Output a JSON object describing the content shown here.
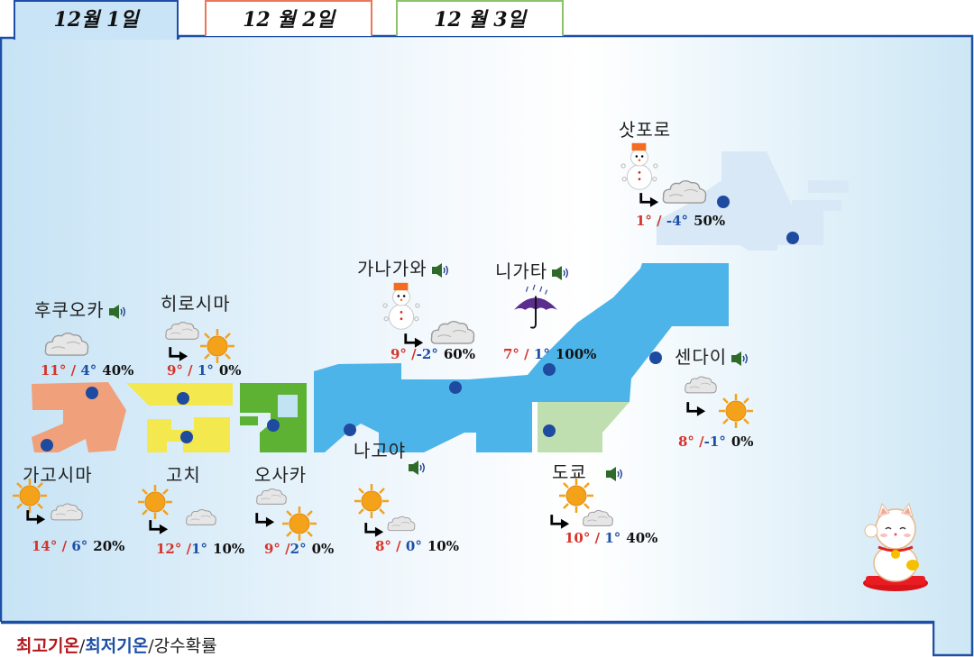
{
  "tabs": [
    "12월 1일",
    "12 월 2일",
    "12 월 3일"
  ],
  "colors": {
    "active_tab": "#c8e4f6",
    "border": "#1e4fa6",
    "high_temp": "#d6332a",
    "low_temp": "#1e4fa6",
    "dot": "#1e4aa0"
  },
  "cities": {
    "sapporo": {
      "name": "삿포로",
      "high": "1°",
      "low": "-4°",
      "rain": "50%",
      "weather": [
        "snowman",
        "cloud"
      ]
    },
    "kanazawa": {
      "name": "가나가와",
      "high": "9°",
      "low": "-2°",
      "rain": "60%",
      "weather": [
        "snowman",
        "cloud"
      ]
    },
    "niigata": {
      "name": "니가타",
      "high": "7°",
      "low": "1°",
      "rain": "100%",
      "weather": [
        "umbrella"
      ]
    },
    "fukuoka": {
      "name": "후쿠오카",
      "high": "11°",
      "low": "4°",
      "rain": "40%",
      "weather": [
        "cloud"
      ]
    },
    "hiroshima": {
      "name": "히로시마",
      "high": "9°",
      "low": "1°",
      "rain": "0%",
      "weather": [
        "cloud",
        "sun"
      ]
    },
    "sendai": {
      "name": "센다이",
      "high": "8°",
      "low": "-1°",
      "rain": "0%",
      "weather": [
        "cloud",
        "sun"
      ]
    },
    "kagoshima": {
      "name": "가고시마",
      "high": "14°",
      "low": "6°",
      "rain": "20%",
      "weather": [
        "sun",
        "cloud"
      ]
    },
    "kochi": {
      "name": "고치",
      "high": "12°",
      "low": "1°",
      "rain": "10%",
      "weather": [
        "sun",
        "cloud"
      ]
    },
    "osaka": {
      "name": "오사카",
      "high": "9°",
      "low": "2°",
      "rain": "0%",
      "weather": [
        "cloud",
        "sun"
      ]
    },
    "nagoya": {
      "name": "나고야",
      "high": "8°",
      "low": "0°",
      "rain": "10%",
      "weather": [
        "sun",
        "cloud"
      ]
    },
    "tokyo": {
      "name": "도쿄",
      "high": "10°",
      "low": "1°",
      "rain": "40%",
      "weather": [
        "sun",
        "cloud"
      ]
    }
  },
  "legend": {
    "high": "최고기온",
    "low": "최저기온",
    "rain": "강수확률",
    "sep": "/"
  },
  "icons": [
    "speaker-icon",
    "sun-icon",
    "cloud-icon",
    "snowman-icon",
    "umbrella-icon",
    "arrow-icon",
    "lucky-cat-icon"
  ]
}
